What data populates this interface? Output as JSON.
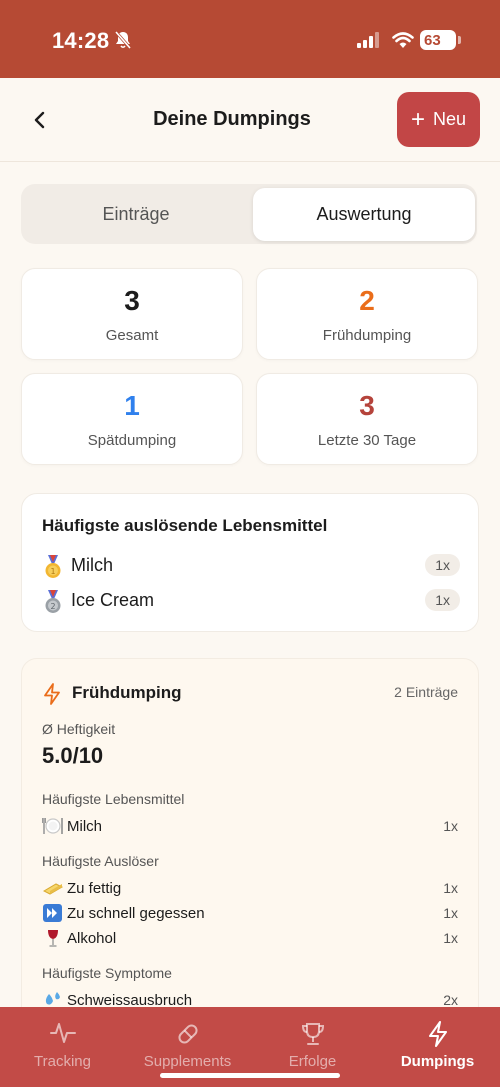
{
  "status_bar": {
    "time": "14:28",
    "battery": "63"
  },
  "nav": {
    "title": "Deine Dumpings",
    "new_label": "Neu"
  },
  "segments": [
    {
      "label": "Einträge",
      "selected": false
    },
    {
      "label": "Auswertung",
      "selected": true
    }
  ],
  "stats": [
    {
      "value": "3",
      "label": "Gesamt",
      "color": "#1c1c1c"
    },
    {
      "value": "2",
      "label": "Frühdumping",
      "color": "#ea6d1a"
    },
    {
      "value": "1",
      "label": "Spätdumping",
      "color": "#2f80ed"
    },
    {
      "value": "3",
      "label": "Letzte 30 Tage",
      "color": "#b5433b"
    }
  ],
  "trigger_foods": {
    "title": "Häufigste auslösende Lebensmittel",
    "items": [
      {
        "icon": "gold-medal-icon",
        "name": "Milch",
        "count": "1x"
      },
      {
        "icon": "silver-medal-icon",
        "name": "Ice Cream",
        "count": "1x"
      }
    ]
  },
  "early_dumping": {
    "title": "Frühdumping",
    "count": "2 Einträge",
    "severity_label": "Ø Heftigkeit",
    "severity_value": "5.0/10",
    "foods_label": "Häufigste Lebensmittel",
    "foods": [
      {
        "icon": "plate-icon",
        "name": "Milch",
        "count": "1x"
      }
    ],
    "triggers_label": "Häufigste Auslöser",
    "triggers": [
      {
        "icon": "butter-icon",
        "name": "Zu fettig",
        "count": "1x"
      },
      {
        "icon": "fast-forward-icon",
        "name": "Zu schnell gegessen",
        "count": "1x"
      },
      {
        "icon": "wine-glass-icon",
        "name": "Alkohol",
        "count": "1x"
      }
    ],
    "symptoms_label": "Häufigste Symptome",
    "symptoms": [
      {
        "icon": "sweat-drops-icon",
        "name": "Schweissausbruch",
        "count": "2x"
      }
    ]
  },
  "tabs": [
    {
      "label": "Tracking",
      "icon": "activity-icon",
      "active": false
    },
    {
      "label": "Supplements",
      "icon": "pill-icon",
      "active": false
    },
    {
      "label": "Erfolge",
      "icon": "trophy-icon",
      "active": false
    },
    {
      "label": "Dumpings",
      "icon": "lightning-icon",
      "active": true
    }
  ],
  "colors": {
    "brand": "#b64a34",
    "tab_bar": "#c24b47",
    "accent_orange": "#ea6d1a",
    "accent_blue": "#2f80ed"
  }
}
